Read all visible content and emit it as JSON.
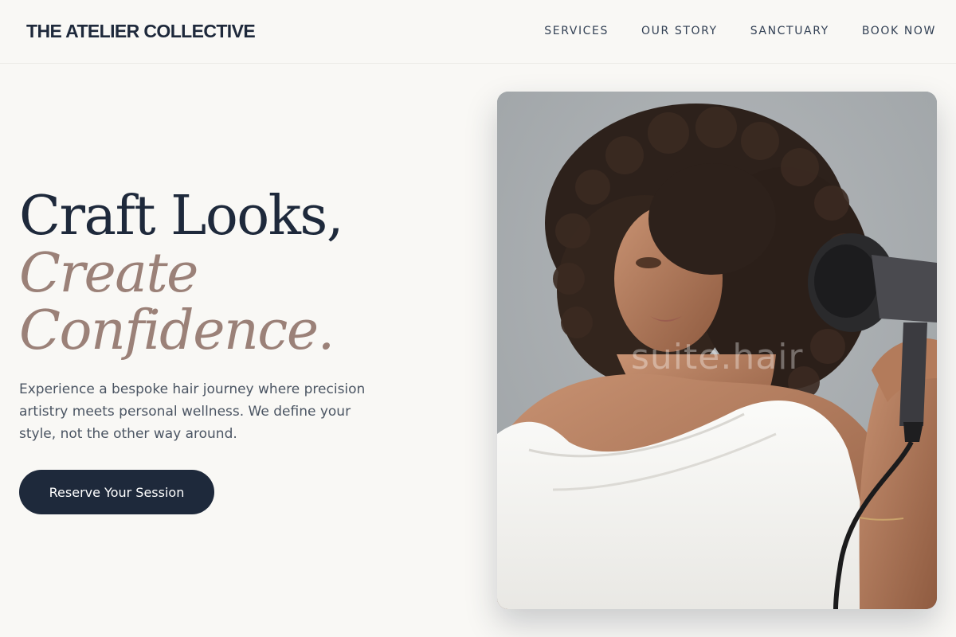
{
  "header": {
    "brand": "THE ATELIER COLLECTIVE",
    "nav": [
      "SERVICES",
      "OUR STORY",
      "SANCTUARY",
      "BOOK NOW"
    ]
  },
  "hero": {
    "title_line1": "Craft Looks,",
    "title_line2": "Create",
    "title_line3": "Confidence.",
    "description": "Experience a bespoke hair journey where precision artistry meets personal wellness. We define your style, not the other way around.",
    "cta_label": "Reserve Your Session"
  },
  "photo": {
    "watermark": "suite.hair"
  },
  "colors": {
    "navy": "#1e293b",
    "accent": "#9b8178",
    "background": "#f9f8f5"
  }
}
